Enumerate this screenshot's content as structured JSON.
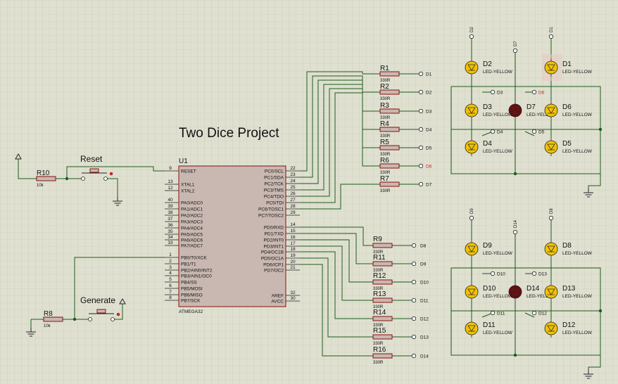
{
  "title": "Two Dice Project",
  "mcu": {
    "ref": "U1",
    "part": "ATMEGA32",
    "left_pins": [
      {
        "num": "9",
        "name": "RESET"
      },
      {
        "num": "13",
        "name": "XTAL1"
      },
      {
        "num": "12",
        "name": "XTAL2"
      },
      {
        "num": "40",
        "name": "PA0/ADC0"
      },
      {
        "num": "39",
        "name": "PA1/ADC1"
      },
      {
        "num": "38",
        "name": "PA2/ADC2"
      },
      {
        "num": "37",
        "name": "PA3/ADC3"
      },
      {
        "num": "36",
        "name": "PA4/ADC4"
      },
      {
        "num": "35",
        "name": "PA5/ADC5"
      },
      {
        "num": "34",
        "name": "PA6/ADC6"
      },
      {
        "num": "33",
        "name": "PA7/ADC7"
      },
      {
        "num": "1",
        "name": "PB0/T0/XCK"
      },
      {
        "num": "2",
        "name": "PB1/T1"
      },
      {
        "num": "3",
        "name": "PB2/AIN0/INT2"
      },
      {
        "num": "4",
        "name": "PB3/AIN1/OC0"
      },
      {
        "num": "5",
        "name": "PB4/SS"
      },
      {
        "num": "6",
        "name": "PB5/MOSI"
      },
      {
        "num": "7",
        "name": "PB6/MISO"
      },
      {
        "num": "8",
        "name": "PB7/SCK"
      }
    ],
    "right_pins": [
      {
        "num": "22",
        "name": "PC0/SCL"
      },
      {
        "num": "23",
        "name": "PC1/SDA"
      },
      {
        "num": "24",
        "name": "PC2/TCK"
      },
      {
        "num": "25",
        "name": "PC3/TMS"
      },
      {
        "num": "26",
        "name": "PC4/TDO"
      },
      {
        "num": "27",
        "name": "PC5/TDI"
      },
      {
        "num": "28",
        "name": "PC6/TOSC1"
      },
      {
        "num": "29",
        "name": "PC7/TOSC2"
      },
      {
        "num": "14",
        "name": "PD0/RXD"
      },
      {
        "num": "15",
        "name": "PD1/TXD"
      },
      {
        "num": "16",
        "name": "PD2/INT0"
      },
      {
        "num": "17",
        "name": "PD3/INT1"
      },
      {
        "num": "18",
        "name": "PD4/OC1B"
      },
      {
        "num": "19",
        "name": "PD5/OC1A"
      },
      {
        "num": "20",
        "name": "PD6/ICP1"
      },
      {
        "num": "21",
        "name": "PD7/OC2"
      },
      {
        "num": "32",
        "name": "AREF"
      },
      {
        "num": "30",
        "name": "AVCC"
      }
    ]
  },
  "resistors_c": [
    {
      "ref": "R1",
      "value": "330R",
      "net": "D1"
    },
    {
      "ref": "R2",
      "value": "330R",
      "net": "D2"
    },
    {
      "ref": "R3",
      "value": "330R",
      "net": "D3"
    },
    {
      "ref": "R4",
      "value": "330R",
      "net": "D4"
    },
    {
      "ref": "R5",
      "value": "330R",
      "net": "D5"
    },
    {
      "ref": "R6",
      "value": "330R",
      "net": "D6"
    },
    {
      "ref": "R7",
      "value": "330R",
      "net": "D7"
    }
  ],
  "resistors_d": [
    {
      "ref": "R9",
      "value": "330R",
      "net": "D8"
    },
    {
      "ref": "R11",
      "value": "330R",
      "net": "D9"
    },
    {
      "ref": "R12",
      "value": "330R",
      "net": "D10"
    },
    {
      "ref": "R13",
      "value": "330R",
      "net": "D11"
    },
    {
      "ref": "R14",
      "value": "330R",
      "net": "D12"
    },
    {
      "ref": "R15",
      "value": "330R",
      "net": "D13"
    },
    {
      "ref": "R16",
      "value": "330R",
      "net": "D14"
    }
  ],
  "reset_circuit": {
    "resistor": "R10",
    "value": "10k",
    "button": "Reset"
  },
  "generate_circuit": {
    "resistor": "R8",
    "value": "10k",
    "button": "Generate"
  },
  "led_type": "LED-YELLOW",
  "die1": [
    {
      "ref": "D2",
      "net": "D2",
      "state": "on"
    },
    {
      "ref": "D1",
      "net": "D1",
      "state": "on"
    },
    {
      "ref": "D3",
      "net": "D3",
      "state": "on"
    },
    {
      "ref": "D7",
      "net": "D7",
      "state": "off"
    },
    {
      "ref": "D6",
      "net": "D6",
      "state": "on"
    },
    {
      "ref": "D4",
      "net": "D4",
      "state": "on"
    },
    {
      "ref": "D5",
      "net": "D5",
      "state": "on"
    }
  ],
  "die2": [
    {
      "ref": "D9",
      "net": "D9",
      "state": "on"
    },
    {
      "ref": "D8",
      "net": "D8",
      "state": "on"
    },
    {
      "ref": "D10",
      "net": "D10",
      "state": "on"
    },
    {
      "ref": "D14",
      "net": "D14",
      "state": "off"
    },
    {
      "ref": "D13",
      "net": "D13",
      "state": "on"
    },
    {
      "ref": "D11",
      "net": "D11",
      "state": "on"
    },
    {
      "ref": "D12",
      "net": "D12",
      "state": "on"
    }
  ],
  "colors": {
    "background": "#dfe0d0",
    "grid": "#c7c8b8",
    "wire": "#1c5b1c",
    "part_outline": "#8a1010",
    "mcu_fill": "#c9b8b1",
    "led_on": "#f2c200",
    "led_off": "#6a0c0c",
    "terminal_highlight": "#c8281e"
  }
}
